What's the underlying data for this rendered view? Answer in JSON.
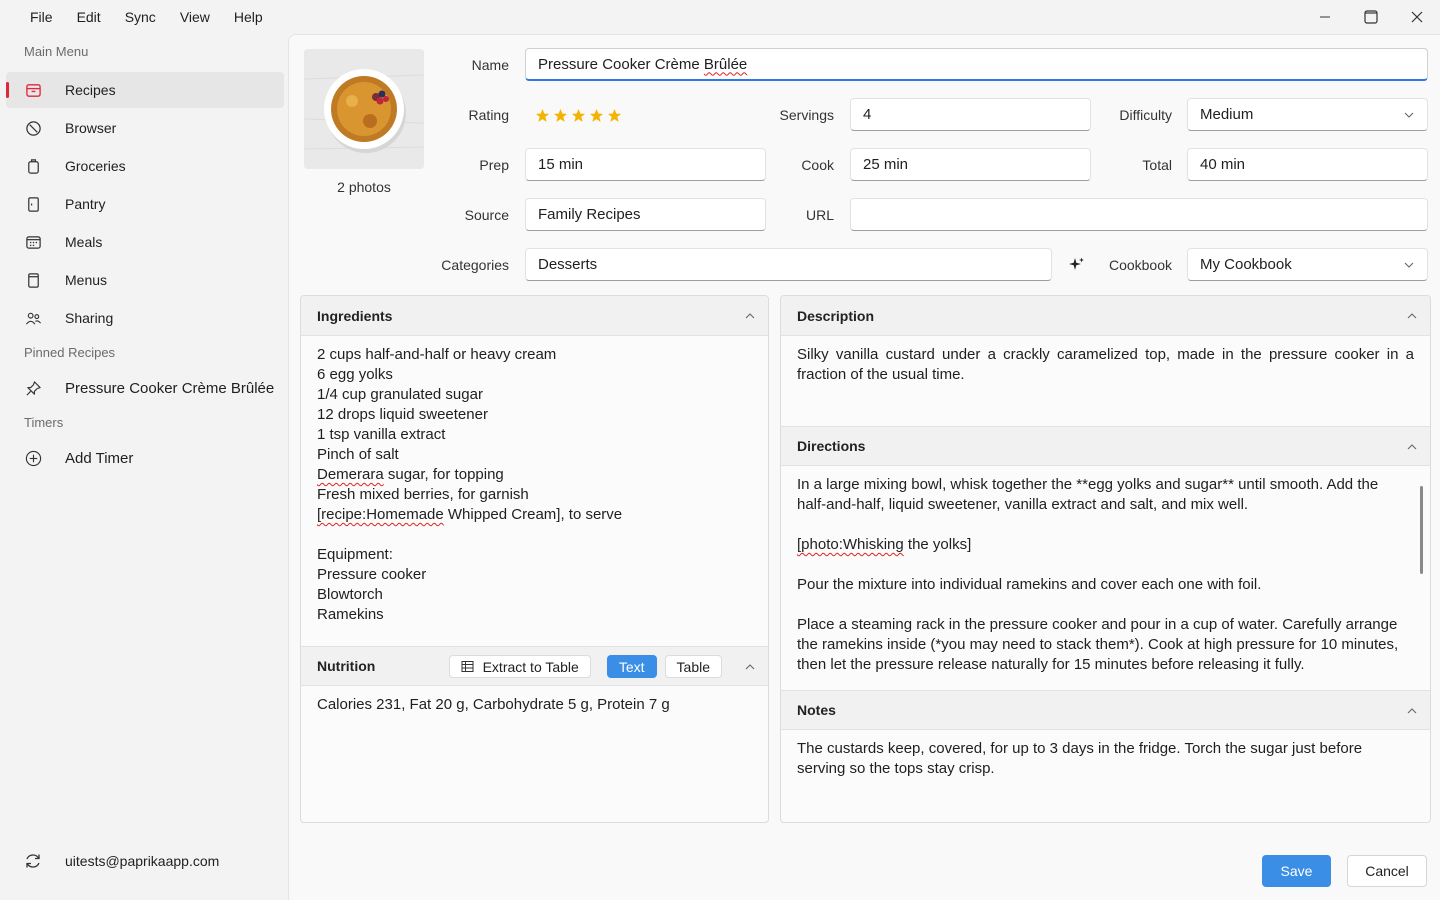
{
  "menu": [
    "File",
    "Edit",
    "Sync",
    "View",
    "Help"
  ],
  "sidebar": {
    "main_menu_label": "Main Menu",
    "items": [
      {
        "label": "Recipes",
        "icon": "recipes-icon"
      },
      {
        "label": "Browser",
        "icon": "browser-icon"
      },
      {
        "label": "Groceries",
        "icon": "groceries-icon"
      },
      {
        "label": "Pantry",
        "icon": "pantry-icon"
      },
      {
        "label": "Meals",
        "icon": "meals-icon"
      },
      {
        "label": "Menus",
        "icon": "menus-icon"
      },
      {
        "label": "Sharing",
        "icon": "sharing-icon"
      }
    ],
    "pinned_label": "Pinned Recipes",
    "pinned_item": "Pressure Cooker Crème Brûlée",
    "timers_label": "Timers",
    "add_timer": "Add Timer",
    "account": "uitests@paprikaapp.com"
  },
  "recipe": {
    "photos_caption": "2 photos",
    "labels": {
      "name": "Name",
      "rating": "Rating",
      "servings": "Servings",
      "difficulty": "Difficulty",
      "prep": "Prep",
      "cook": "Cook",
      "total": "Total",
      "source": "Source",
      "url": "URL",
      "categories": "Categories",
      "cookbook": "Cookbook"
    },
    "name_plain": "Pressure Cooker Crème ",
    "name_flagged": "Brûlée",
    "rating": 5,
    "servings": "4",
    "difficulty": "Medium",
    "prep": "15 min",
    "cook": "25 min",
    "total": "40 min",
    "source": "Family Recipes",
    "url": "",
    "categories": "Desserts",
    "cookbook": "My Cookbook"
  },
  "ingredients": {
    "title": "Ingredients",
    "lines": [
      "2 cups half-and-half or heavy cream",
      "6 egg yolks",
      "1/4 cup granulated sugar",
      "12 drops liquid sweetener",
      "1 tsp vanilla extract",
      "Pinch of salt",
      "Demerara sugar, for topping",
      "Fresh mixed berries, for garnish",
      "[recipe:Homemade Whipped Cream], to serve",
      "",
      "Equipment:",
      "Pressure cooker",
      "Blowtorch",
      "Ramekins"
    ]
  },
  "nutrition": {
    "title": "Nutrition",
    "extract_label": "Extract to Table",
    "text_label": "Text",
    "table_label": "Table",
    "body": "Calories 231, Fat 20 g, Carbohydrate 5 g, Protein 7 g"
  },
  "description": {
    "title": "Description",
    "body": "Silky vanilla custard under a crackly caramelized top, made in the pressure cooker in a fraction of the usual time."
  },
  "directions": {
    "title": "Directions",
    "p1": "In a large mixing bowl, whisk together the **egg yolks and sugar** until smooth. Add the half-and-half, liquid sweetener, vanilla extract and salt, and mix well.",
    "p2_flagged": "[photo:Whisking",
    "p2_rest": " the yolks]",
    "p3": "Pour the mixture into individual ramekins and cover each one with foil.",
    "p4": "Place a steaming rack in the pressure cooker and pour in a cup of water. Carefully arrange the ramekins inside (*you may need to stack them*). Cook at high pressure for 10 minutes, then let the pressure release naturally for 15 minutes before releasing it fully."
  },
  "notes": {
    "title": "Notes",
    "body": "The custards keep, covered, for up to 3 days in the fridge. Torch the sugar just before serving so the tops stay crisp."
  },
  "actions": {
    "save": "Save",
    "cancel": "Cancel"
  },
  "colors": {
    "accent": "#3a8ee6",
    "active_marker": "#e0263a",
    "star": "#f5b301",
    "focus": "#2a7ae2"
  }
}
